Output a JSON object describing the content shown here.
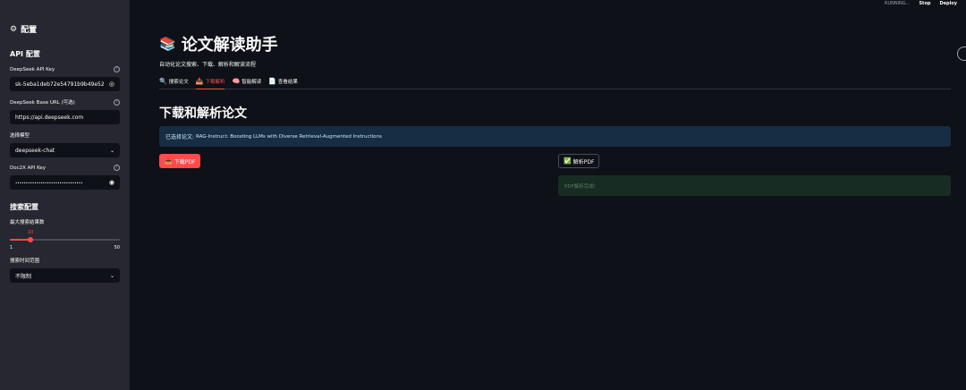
{
  "sidebar": {
    "title": "配置",
    "api_heading": "API 配置",
    "deepseek_key": {
      "label": "DeepSeek API Key",
      "value": "sk-5eba1deb72e54791b9b49e52"
    },
    "base_url": {
      "label": "DeepSeek Base URL (可选)",
      "value": "https://api.deepseek.com"
    },
    "model": {
      "label": "选择模型",
      "value": "deepseek-chat"
    },
    "doc2x_key": {
      "label": "Doc2X API Key",
      "value": "••••••••••••••••••••••••••••••••"
    },
    "search_heading": "搜索配置",
    "max_results": {
      "label": "最大搜索结果数",
      "value": 10,
      "min": 1,
      "max": 50,
      "value_label": "10",
      "min_label": "1",
      "max_label": "50"
    },
    "time_range": {
      "label": "搜索时间范围",
      "value": "不限制"
    }
  },
  "topbar": {
    "status": "RUNNING...",
    "stop": "Stop",
    "deploy": "Deploy"
  },
  "main": {
    "app_title": "论文解读助手",
    "app_subtitle": "自动化论文搜索、下载、解析和解读流程",
    "tabs": [
      {
        "icon": "🔍",
        "label": "搜索论文"
      },
      {
        "icon": "📥",
        "label": "下载解析"
      },
      {
        "icon": "🧠",
        "label": "智能解读"
      },
      {
        "icon": "📄",
        "label": "查看结果"
      }
    ],
    "section_title": "下载和解析论文",
    "info_prefix": "已选择论文:",
    "info_paper": "RAG-Instruct: Boosting LLMs with Diverse Retrieval-Augmented Instructions",
    "download_button": "下载PDF",
    "parse_button": "解析PDF",
    "parse_success": "PDF解析完成!"
  },
  "colors": {
    "accent": "#ff4b4b",
    "background": "#0e1117",
    "sidebar": "#262730",
    "info_bg": "#172d43",
    "success_bg": "#172d24"
  }
}
